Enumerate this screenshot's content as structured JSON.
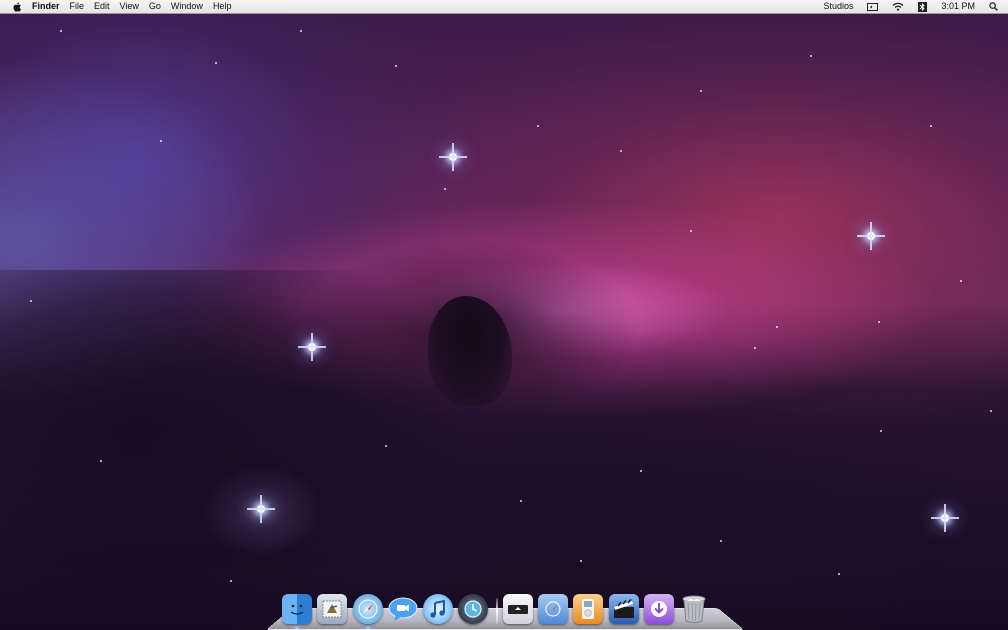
{
  "menubar": {
    "apple_icon": "apple-logo-icon",
    "app_name": "Finder",
    "menus": [
      "File",
      "Edit",
      "View",
      "Go",
      "Window",
      "Help"
    ],
    "user": "Studios",
    "status_icons": [
      "volume-icon",
      "wifi-icon",
      "bluetooth-icon"
    ],
    "clock": "3:01 PM",
    "spotlight_icon": "spotlight-search-icon"
  },
  "desktop": {
    "wallpaper": "horsehead nebula",
    "colors": {
      "nebula_pink": "#e84fc0",
      "sky_purple": "#5a2458",
      "dark_cloud": "#160a22"
    }
  },
  "dock": {
    "apps": [
      {
        "icon": "finder-icon",
        "color": "#3a8fe0",
        "running": true
      },
      {
        "icon": "mail-icon",
        "color": "#6a7ea8",
        "running": false
      },
      {
        "icon": "safari-icon",
        "color": "#8fc4ee",
        "running": true
      },
      {
        "icon": "ichat-icon",
        "color": "#4aa3f0",
        "running": false
      },
      {
        "icon": "itunes-icon",
        "color": "#8ac8f8",
        "running": false
      },
      {
        "icon": "time-machine-icon",
        "color": "#3a4a5a",
        "running": false
      }
    ],
    "docs": [
      {
        "icon": "applications-stack-icon",
        "color": "#e8e8ec"
      },
      {
        "icon": "utilities-stack-icon",
        "color": "#78a8e0"
      },
      {
        "icon": "ipod-icon",
        "color": "#f0a850"
      },
      {
        "icon": "movies-stack-icon",
        "color": "#5a8fd8"
      },
      {
        "icon": "downloads-stack-icon",
        "color": "#b07ae8"
      },
      {
        "icon": "trash-icon",
        "color": "#c8cdd2"
      }
    ]
  }
}
